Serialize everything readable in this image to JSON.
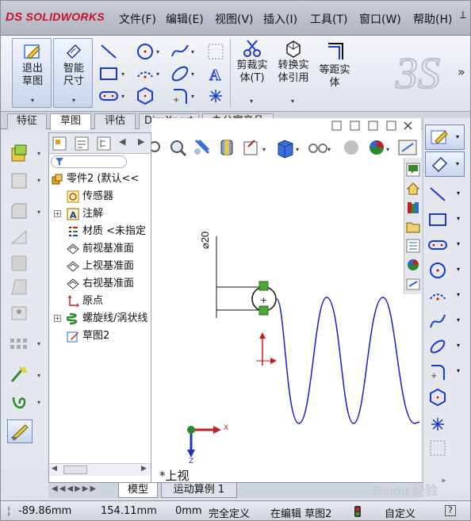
{
  "app": {
    "logo_text": "SOLIDWORKS",
    "logo_prefix": "DS"
  },
  "menu": [
    "文件(F)",
    "编辑(E)",
    "视图(V)",
    "插入(I)",
    "工具(T)",
    "窗口(W)",
    "帮助(H)"
  ],
  "window_buttons": {
    "pin": "⊥",
    "minimize": "–",
    "restore": "□",
    "close": "✕"
  },
  "ribbon": {
    "exit_sketch": "退出草图",
    "smart_dim": "智能尺寸",
    "trim": "剪裁实体(T)",
    "convert": "转换实体引用",
    "offset": "等距实体",
    "more": "»"
  },
  "tabs": [
    "特征",
    "草图",
    "评估",
    "DimXpert",
    "办公室产品"
  ],
  "active_tab": "草图",
  "tree": {
    "items": [
      {
        "label": "零件2 (默认<<",
        "icon": "part-icon",
        "expander": ""
      },
      {
        "label": "传感器",
        "icon": "sensor-icon",
        "expander": ""
      },
      {
        "label": "注解",
        "icon": "annotation-icon",
        "expander": "+"
      },
      {
        "label": "材质 <未指定",
        "icon": "material-icon",
        "expander": ""
      },
      {
        "label": "前视基准面",
        "icon": "plane-icon",
        "expander": ""
      },
      {
        "label": "上视基准面",
        "icon": "plane-icon",
        "expander": ""
      },
      {
        "label": "右视基准面",
        "icon": "plane-icon",
        "expander": ""
      },
      {
        "label": "原点",
        "icon": "origin-icon",
        "expander": ""
      },
      {
        "label": "螺旋线/涡状线",
        "icon": "helix-icon",
        "expander": "+"
      },
      {
        "label": "草图2",
        "icon": "sketch-icon",
        "expander": ""
      }
    ]
  },
  "viewport": {
    "dimension_label": "⌀20",
    "view_label": "*上视",
    "axis_x": "X",
    "axis_z": "Z"
  },
  "bottom_tabs": [
    "模型",
    "运动算例 1"
  ],
  "status": {
    "x": "-89.86mm",
    "y": "154.11mm",
    "z": "0mm",
    "definition": "完全定义",
    "editing": "在编辑 草图2",
    "custom": "自定义",
    "help": "?"
  },
  "watermark": "Baidu 经验",
  "colors": {
    "logo_red": "#c8102e",
    "sketch_blue": "#1a1acc",
    "accent": "#3a6fd8"
  }
}
